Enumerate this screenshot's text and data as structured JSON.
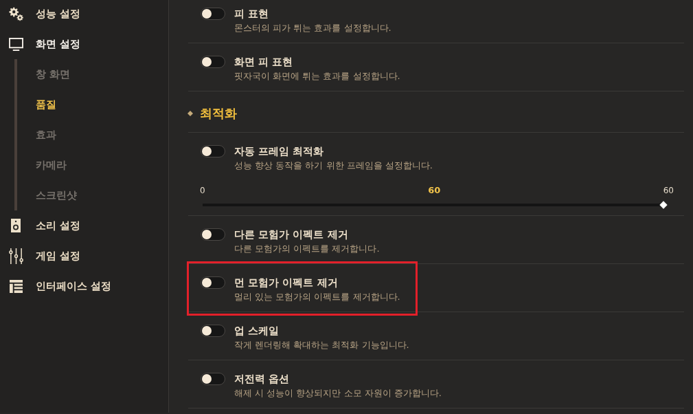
{
  "sidebar": {
    "items": [
      {
        "label": "성능 설정",
        "expanded": false
      },
      {
        "label": "화면 설정",
        "expanded": true,
        "children": [
          {
            "label": "창 화면",
            "selected": false
          },
          {
            "label": "품질",
            "selected": true
          },
          {
            "label": "효과",
            "selected": false
          },
          {
            "label": "카메라",
            "selected": false
          },
          {
            "label": "스크린샷",
            "selected": false
          }
        ]
      },
      {
        "label": "소리 설정",
        "expanded": false
      },
      {
        "label": "게임 설정",
        "expanded": false
      },
      {
        "label": "인터페이스 설정",
        "expanded": false
      }
    ]
  },
  "settings": {
    "items": [
      {
        "kind": "toggle",
        "title": "피 표현",
        "description": "몬스터의 피가 튀는 효과를 설정합니다.",
        "on": false,
        "highlighted": false
      },
      {
        "kind": "toggle",
        "title": "화면 피 표현",
        "description": "핏자국이 화면에 튀는 효과를 설정합니다.",
        "on": false,
        "highlighted": false
      },
      {
        "kind": "section",
        "title": "최적화"
      },
      {
        "kind": "toggle",
        "title": "자동 프레임 최적화",
        "description": "성능 향상 동작을 하기 위한 프레임을 설정합니다.",
        "on": false,
        "highlighted": false,
        "slider": {
          "min_label": "0",
          "value_label": "60",
          "max_label": "60",
          "level": 1
        }
      },
      {
        "kind": "toggle",
        "title": "다른 모험가 이펙트 제거",
        "description": "다른 모험가의 이펙트를 제거합니다.",
        "on": false,
        "highlighted": false
      },
      {
        "kind": "toggle",
        "title": "먼 모험가 이펙트 제거",
        "description": "멀리 있는 모험가의 이펙트를 제거합니다.",
        "on": false,
        "highlighted": true
      },
      {
        "kind": "toggle",
        "title": "업 스케일",
        "description": "작게 렌더링해 확대하는 최적화 기능입니다.",
        "on": false,
        "highlighted": false
      },
      {
        "kind": "toggle",
        "title": "저전력 옵션",
        "description": "해제 시 성능이 향상되지만 소모 자원이 증가합니다.",
        "on": false,
        "highlighted": false
      }
    ]
  }
}
